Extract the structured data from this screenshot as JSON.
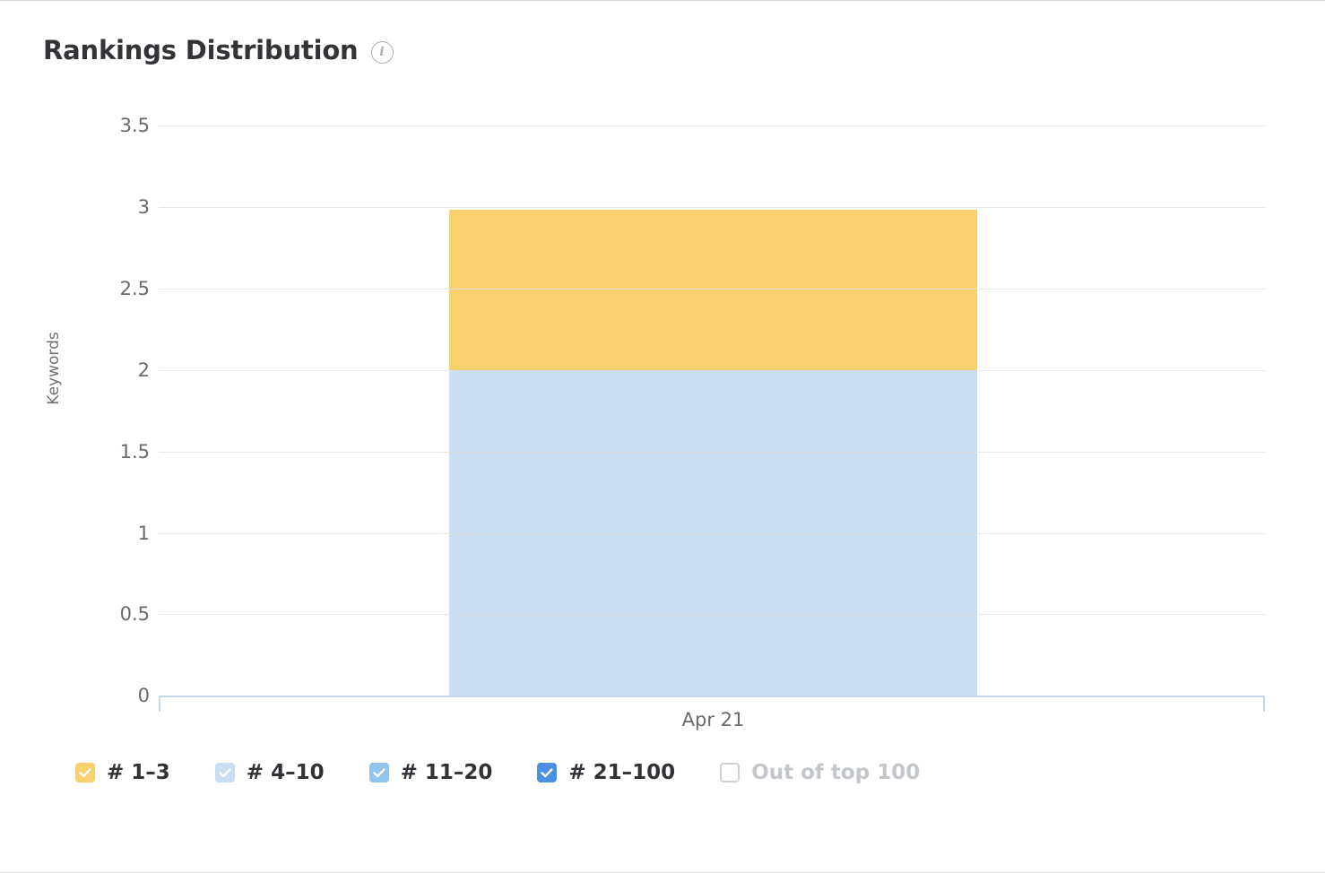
{
  "header": {
    "title": "Rankings Distribution",
    "info_icon": "info-circle-icon",
    "info_glyph": "i"
  },
  "chart_data": {
    "type": "bar",
    "subtype": "stacked-column",
    "title": "Rankings Distribution",
    "xlabel": "",
    "ylabel": "Keywords",
    "categories": [
      "Apr 21"
    ],
    "ytick_labels": [
      "3.5",
      "3",
      "2.5",
      "2",
      "1.5",
      "1",
      "0.5",
      "0"
    ],
    "ytick_values": [
      3.5,
      3,
      2.5,
      2,
      1.5,
      1,
      0.5,
      0
    ],
    "ylim": [
      0,
      3.5
    ],
    "grid": true,
    "legend_position": "bottom",
    "series": [
      {
        "name": "# 1–3",
        "values": [
          1
        ],
        "color": "#f8d06e",
        "visible": true
      },
      {
        "name": "# 4–10",
        "values": [
          2
        ],
        "color": "#c9def2",
        "visible": true
      },
      {
        "name": "# 11–20",
        "values": [
          0
        ],
        "color": "#91c3ec",
        "visible": true
      },
      {
        "name": "# 21–100",
        "values": [
          0
        ],
        "color": "#4a90e2",
        "visible": true
      },
      {
        "name": "Out of top 100",
        "values": [
          0
        ],
        "color": "#cdd2d7",
        "visible": false
      }
    ],
    "total": 3
  },
  "legend": {
    "items": [
      {
        "label": "# 1–3",
        "color": "#f8d06e",
        "checked": true,
        "check_color": "#ffffff"
      },
      {
        "label": "# 4–10",
        "color": "#c9def2",
        "checked": true,
        "check_color": "#ffffff"
      },
      {
        "label": "# 11–20",
        "color": "#91c3ec",
        "checked": true,
        "check_color": "#ffffff"
      },
      {
        "label": "# 21–100",
        "color": "#4a90e2",
        "checked": true,
        "check_color": "#ffffff"
      },
      {
        "label": "Out of top 100",
        "color": "#ffffff",
        "checked": false,
        "check_color": "#ffffff"
      }
    ]
  },
  "axis": {
    "y_title": "Keywords",
    "x_labels": [
      "Apr 21"
    ]
  },
  "colors": {
    "gridline": "#e6e6e6",
    "axis_line": "#c6d6ea",
    "tick_text": "#6a6a6e",
    "title_text": "#333438",
    "card_border": "#d6d6d6"
  }
}
